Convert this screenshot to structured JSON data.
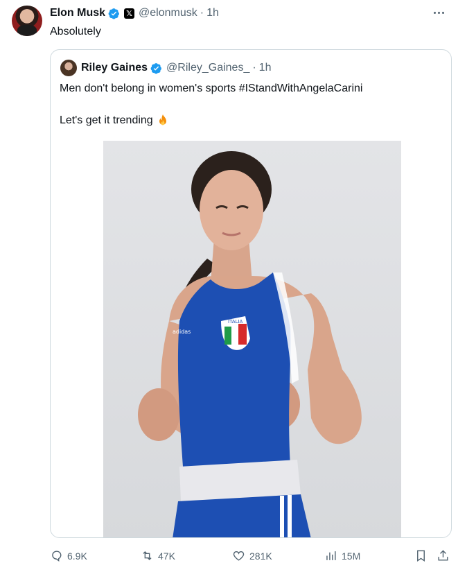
{
  "tweet": {
    "author_name": "Elon Musk",
    "author_handle": "@elonmusk",
    "separator": "·",
    "time": "1h",
    "text": "Absolutely",
    "badge_letter": "𝕏"
  },
  "quoted": {
    "author_name": "Riley Gaines",
    "author_handle": "@Riley_Gaines_",
    "separator": "·",
    "time": "1h",
    "line1": "Men don't belong in women's sports #IStandWithAngelaCarini",
    "line2": "Let's get it trending",
    "photo_emblem_text": "ITALIA",
    "photo_brand": "adidas"
  },
  "actions": {
    "replies": "6.9K",
    "reposts": "47K",
    "likes": "281K",
    "views": "15M"
  },
  "colors": {
    "verified": "#1d9bf0",
    "text_secondary": "#536471",
    "border": "#cfd9de",
    "jersey_blue": "#1d4fb3"
  }
}
